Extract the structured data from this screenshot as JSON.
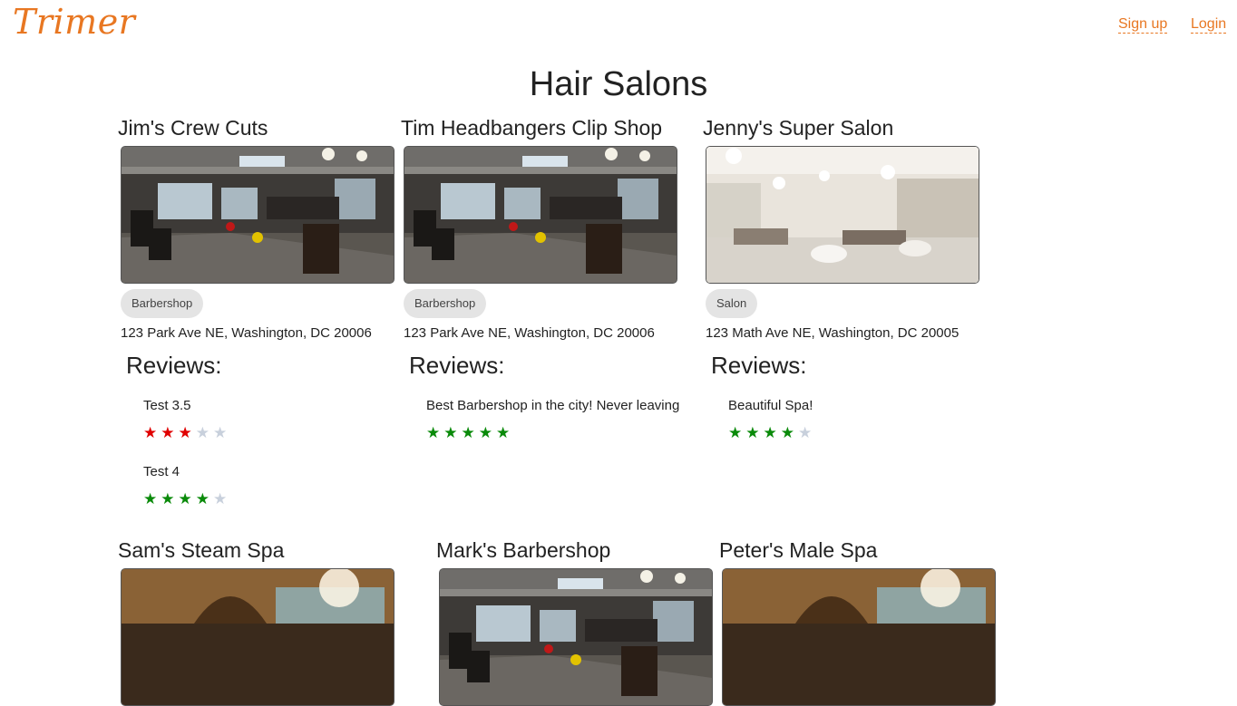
{
  "header": {
    "logo": "Trimer",
    "signup_label": "Sign up",
    "login_label": "Login"
  },
  "page_title": "Hair Salons",
  "reviews_heading": "Reviews:",
  "colors": {
    "brand": "#e87722",
    "star_red": "#e00000",
    "star_green": "#0a8a0a",
    "star_empty": "#c8d0dc"
  },
  "salons": [
    {
      "name": "Jim's Crew Cuts",
      "category": "Barbershop",
      "address": "123 Park Ave NE, Washington, DC 20006",
      "image": "industrial-barbershop-photo",
      "reviews": [
        {
          "text": "Test 3.5",
          "rating": 3,
          "max": 5,
          "star_color": "red"
        },
        {
          "text": "Test 4",
          "rating": 4,
          "max": 5,
          "star_color": "green"
        }
      ]
    },
    {
      "name": "Tim Headbangers Clip Shop",
      "category": "Barbershop",
      "address": "123 Park Ave NE, Washington, DC 20006",
      "image": "industrial-barbershop-photo",
      "reviews": [
        {
          "text": "Best Barbershop in the city! Never leaving",
          "rating": 5,
          "max": 5,
          "star_color": "green"
        }
      ]
    },
    {
      "name": "Jenny's Super Salon",
      "category": "Salon",
      "address": "123 Math Ave NE, Washington, DC 20005",
      "image": "bright-salon-photo",
      "reviews": [
        {
          "text": "Beautiful Spa!",
          "rating": 4,
          "max": 5,
          "star_color": "green"
        }
      ]
    },
    {
      "name": "Sam's Steam Spa",
      "image": "spa-photo"
    },
    {
      "name": "Mark's Barbershop",
      "image": "industrial-barbershop-photo"
    },
    {
      "name": "Peter's Male Spa",
      "image": "spa-photo"
    }
  ]
}
